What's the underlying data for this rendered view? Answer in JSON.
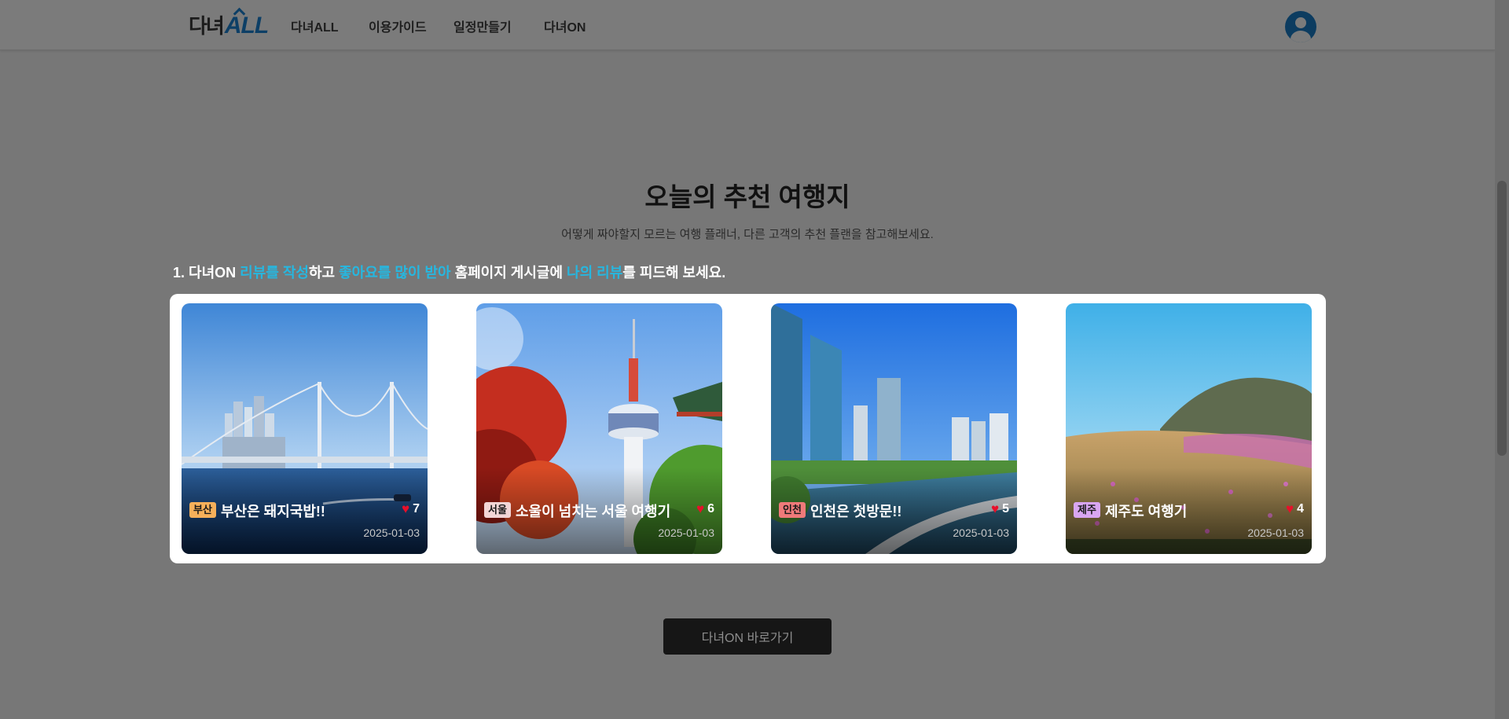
{
  "header": {
    "logo": {
      "part1": "다녀",
      "part2": "ALL"
    },
    "nav": [
      "다녀ALL",
      "이용가이드",
      "일정만들기",
      "다녀ON"
    ],
    "avatar_icon": "user-icon"
  },
  "section": {
    "title": "오늘의 추천 여행지",
    "subtitle": "어떻게 짜야할지 모르는 여행 플래너, 다른 고객의 추천 플랜을 참고해보세요.",
    "instruction": {
      "p1": "1. 다녀ON ",
      "h1": "리뷰를 작성",
      "p2": "하고 ",
      "h2": "좋아요를 많이 받아",
      "p3": " 홈페이지 게시글에 ",
      "h3": "나의 리뷰",
      "p4": "를 피드해 보세요."
    },
    "highlight_color": "#26b7e0"
  },
  "cards": [
    {
      "tag": "부산",
      "tag_color": "#f6b05a",
      "title": "부산은 돼지국밥!!",
      "likes": "7",
      "date": "2025-01-03"
    },
    {
      "tag": "서울",
      "tag_color": "#f3d6d6",
      "title": "소울이 넘치는 서울 여행기",
      "likes": "6",
      "date": "2025-01-03"
    },
    {
      "tag": "인천",
      "tag_color": "#f07a7a",
      "title": "인천은 첫방문!!",
      "likes": "5",
      "date": "2025-01-03"
    },
    {
      "tag": "제주",
      "tag_color": "#d9a6f2",
      "title": "제주도 여행기",
      "likes": "4",
      "date": "2025-01-03"
    }
  ],
  "cta": {
    "label": "다녀ON 바로가기"
  }
}
